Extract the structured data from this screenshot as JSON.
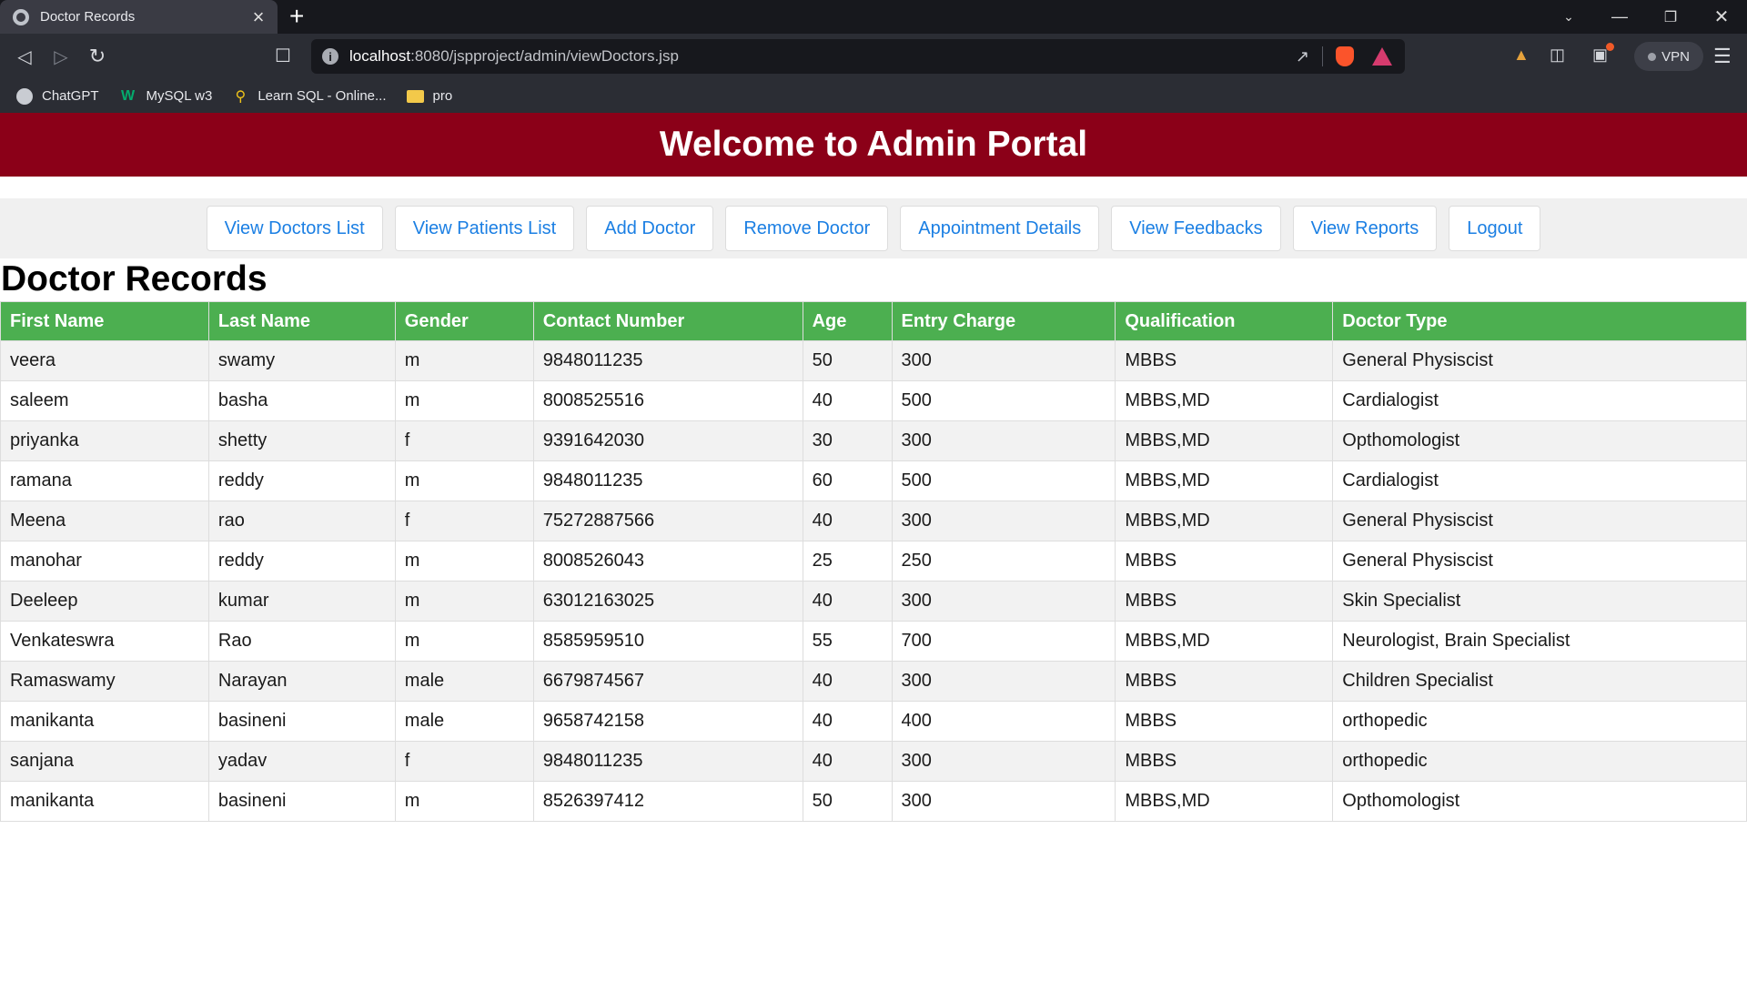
{
  "browser": {
    "tab_title": "Doctor Records",
    "tab_close": "×",
    "new_tab": "+",
    "url_host": "localhost",
    "url_rest": ":8080/jspproject/admin/viewDoctors.jsp",
    "vpn_label": "VPN",
    "bookmarks": [
      {
        "label": "ChatGPT"
      },
      {
        "label": "MySQL w3"
      },
      {
        "label": "Learn SQL - Online..."
      },
      {
        "label": "pro"
      }
    ]
  },
  "portal": {
    "title": "Welcome to Admin Portal"
  },
  "nav": [
    {
      "label": "View Doctors List"
    },
    {
      "label": "View Patients List"
    },
    {
      "label": "Add Doctor"
    },
    {
      "label": "Remove Doctor"
    },
    {
      "label": "Appointment Details"
    },
    {
      "label": "View Feedbacks"
    },
    {
      "label": "View Reports"
    },
    {
      "label": "Logout"
    }
  ],
  "page": {
    "heading": "Doctor Records"
  },
  "table": {
    "columns": [
      "First Name",
      "Last Name",
      "Gender",
      "Contact Number",
      "Age",
      "Entry Charge",
      "Qualification",
      "Doctor Type"
    ],
    "rows": [
      [
        "veera",
        "swamy",
        "m",
        "9848011235",
        "50",
        "300",
        "MBBS",
        "General Physiscist"
      ],
      [
        "saleem",
        "basha",
        "m",
        "8008525516",
        "40",
        "500",
        "MBBS,MD",
        "Cardialogist"
      ],
      [
        "priyanka",
        "shetty",
        "f",
        "9391642030",
        "30",
        "300",
        "MBBS,MD",
        "Opthomologist"
      ],
      [
        "ramana",
        "reddy",
        "m",
        "9848011235",
        "60",
        "500",
        "MBBS,MD",
        "Cardialogist"
      ],
      [
        "Meena",
        "rao",
        "f",
        "75272887566",
        "40",
        "300",
        "MBBS,MD",
        "General Physiscist"
      ],
      [
        "manohar",
        "reddy",
        "m",
        "8008526043",
        "25",
        "250",
        "MBBS",
        "General Physiscist"
      ],
      [
        "Deeleep",
        "kumar",
        "m",
        "63012163025",
        "40",
        "300",
        "MBBS",
        "Skin Specialist"
      ],
      [
        "Venkateswra",
        "Rao",
        "m",
        "8585959510",
        "55",
        "700",
        "MBBS,MD",
        "Neurologist, Brain Specialist"
      ],
      [
        "Ramaswamy",
        "Narayan",
        "male",
        "6679874567",
        "40",
        "300",
        "MBBS",
        "Children Specialist"
      ],
      [
        "manikanta",
        "basineni",
        "male",
        "9658742158",
        "40",
        "400",
        "MBBS",
        "orthopedic"
      ],
      [
        "sanjana",
        "yadav",
        "f",
        "9848011235",
        "40",
        "300",
        "MBBS",
        "orthopedic"
      ],
      [
        "manikanta",
        "basineni",
        "m",
        "8526397412",
        "50",
        "300",
        "MBBS,MD",
        "Opthomologist"
      ]
    ]
  },
  "colors": {
    "header_bg": "#8b0018",
    "table_header_bg": "#4caf50",
    "link_blue": "#1b7fe3"
  }
}
